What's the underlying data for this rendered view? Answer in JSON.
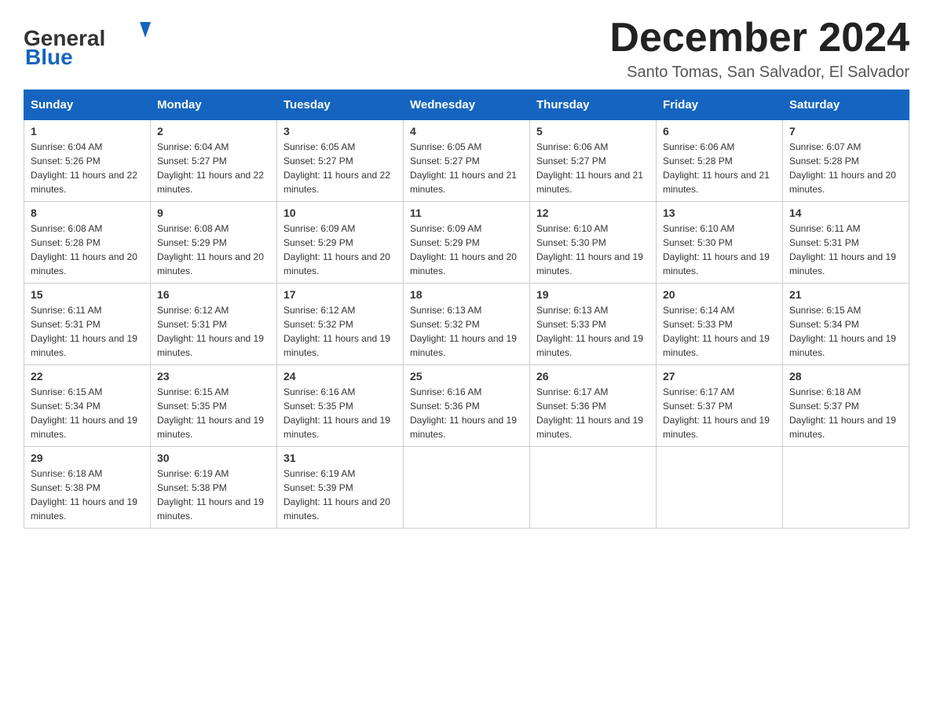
{
  "header": {
    "logo": {
      "general_text": "General",
      "blue_text": "Blue"
    },
    "title": "December 2024",
    "location": "Santo Tomas, San Salvador, El Salvador"
  },
  "calendar": {
    "days_of_week": [
      "Sunday",
      "Monday",
      "Tuesday",
      "Wednesday",
      "Thursday",
      "Friday",
      "Saturday"
    ],
    "weeks": [
      [
        {
          "day": 1,
          "sunrise": "6:04 AM",
          "sunset": "5:26 PM",
          "daylight": "11 hours and 22 minutes."
        },
        {
          "day": 2,
          "sunrise": "6:04 AM",
          "sunset": "5:27 PM",
          "daylight": "11 hours and 22 minutes."
        },
        {
          "day": 3,
          "sunrise": "6:05 AM",
          "sunset": "5:27 PM",
          "daylight": "11 hours and 22 minutes."
        },
        {
          "day": 4,
          "sunrise": "6:05 AM",
          "sunset": "5:27 PM",
          "daylight": "11 hours and 21 minutes."
        },
        {
          "day": 5,
          "sunrise": "6:06 AM",
          "sunset": "5:27 PM",
          "daylight": "11 hours and 21 minutes."
        },
        {
          "day": 6,
          "sunrise": "6:06 AM",
          "sunset": "5:28 PM",
          "daylight": "11 hours and 21 minutes."
        },
        {
          "day": 7,
          "sunrise": "6:07 AM",
          "sunset": "5:28 PM",
          "daylight": "11 hours and 20 minutes."
        }
      ],
      [
        {
          "day": 8,
          "sunrise": "6:08 AM",
          "sunset": "5:28 PM",
          "daylight": "11 hours and 20 minutes."
        },
        {
          "day": 9,
          "sunrise": "6:08 AM",
          "sunset": "5:29 PM",
          "daylight": "11 hours and 20 minutes."
        },
        {
          "day": 10,
          "sunrise": "6:09 AM",
          "sunset": "5:29 PM",
          "daylight": "11 hours and 20 minutes."
        },
        {
          "day": 11,
          "sunrise": "6:09 AM",
          "sunset": "5:29 PM",
          "daylight": "11 hours and 20 minutes."
        },
        {
          "day": 12,
          "sunrise": "6:10 AM",
          "sunset": "5:30 PM",
          "daylight": "11 hours and 19 minutes."
        },
        {
          "day": 13,
          "sunrise": "6:10 AM",
          "sunset": "5:30 PM",
          "daylight": "11 hours and 19 minutes."
        },
        {
          "day": 14,
          "sunrise": "6:11 AM",
          "sunset": "5:31 PM",
          "daylight": "11 hours and 19 minutes."
        }
      ],
      [
        {
          "day": 15,
          "sunrise": "6:11 AM",
          "sunset": "5:31 PM",
          "daylight": "11 hours and 19 minutes."
        },
        {
          "day": 16,
          "sunrise": "6:12 AM",
          "sunset": "5:31 PM",
          "daylight": "11 hours and 19 minutes."
        },
        {
          "day": 17,
          "sunrise": "6:12 AM",
          "sunset": "5:32 PM",
          "daylight": "11 hours and 19 minutes."
        },
        {
          "day": 18,
          "sunrise": "6:13 AM",
          "sunset": "5:32 PM",
          "daylight": "11 hours and 19 minutes."
        },
        {
          "day": 19,
          "sunrise": "6:13 AM",
          "sunset": "5:33 PM",
          "daylight": "11 hours and 19 minutes."
        },
        {
          "day": 20,
          "sunrise": "6:14 AM",
          "sunset": "5:33 PM",
          "daylight": "11 hours and 19 minutes."
        },
        {
          "day": 21,
          "sunrise": "6:15 AM",
          "sunset": "5:34 PM",
          "daylight": "11 hours and 19 minutes."
        }
      ],
      [
        {
          "day": 22,
          "sunrise": "6:15 AM",
          "sunset": "5:34 PM",
          "daylight": "11 hours and 19 minutes."
        },
        {
          "day": 23,
          "sunrise": "6:15 AM",
          "sunset": "5:35 PM",
          "daylight": "11 hours and 19 minutes."
        },
        {
          "day": 24,
          "sunrise": "6:16 AM",
          "sunset": "5:35 PM",
          "daylight": "11 hours and 19 minutes."
        },
        {
          "day": 25,
          "sunrise": "6:16 AM",
          "sunset": "5:36 PM",
          "daylight": "11 hours and 19 minutes."
        },
        {
          "day": 26,
          "sunrise": "6:17 AM",
          "sunset": "5:36 PM",
          "daylight": "11 hours and 19 minutes."
        },
        {
          "day": 27,
          "sunrise": "6:17 AM",
          "sunset": "5:37 PM",
          "daylight": "11 hours and 19 minutes."
        },
        {
          "day": 28,
          "sunrise": "6:18 AM",
          "sunset": "5:37 PM",
          "daylight": "11 hours and 19 minutes."
        }
      ],
      [
        {
          "day": 29,
          "sunrise": "6:18 AM",
          "sunset": "5:38 PM",
          "daylight": "11 hours and 19 minutes."
        },
        {
          "day": 30,
          "sunrise": "6:19 AM",
          "sunset": "5:38 PM",
          "daylight": "11 hours and 19 minutes."
        },
        {
          "day": 31,
          "sunrise": "6:19 AM",
          "sunset": "5:39 PM",
          "daylight": "11 hours and 20 minutes."
        },
        null,
        null,
        null,
        null
      ]
    ]
  }
}
